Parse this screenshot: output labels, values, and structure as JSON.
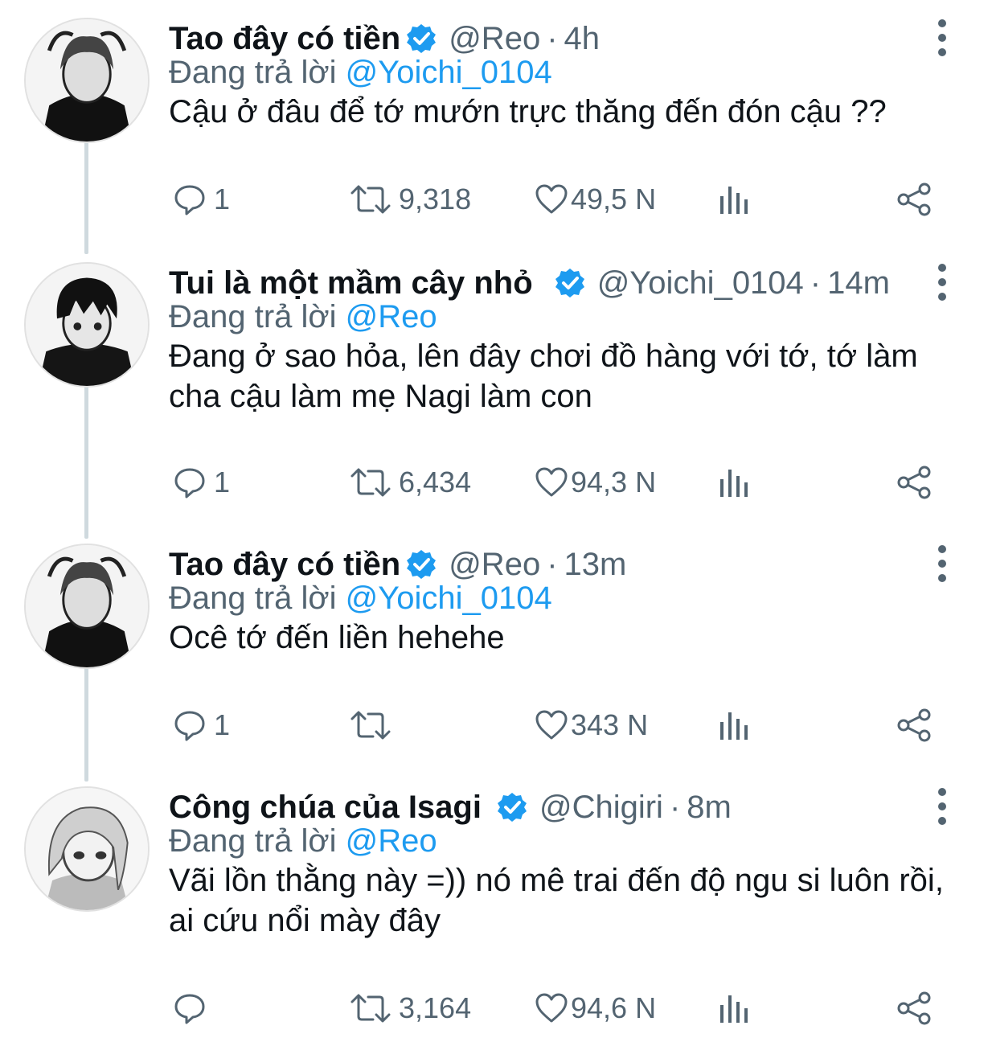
{
  "colors": {
    "accent": "#1d9bf0",
    "text": "#0f1419",
    "muted": "#536471",
    "thread_line": "#cfd9de"
  },
  "labels": {
    "replying_to": "Đang trả lời"
  },
  "icons": {
    "verified": "verified-badge-icon",
    "more": "more-vertical-icon",
    "reply": "reply-icon",
    "retweet": "retweet-icon",
    "like": "heart-icon",
    "analytics": "analytics-icon",
    "share": "share-icon"
  },
  "tweets": [
    {
      "display_name": "Tao đây có tiền",
      "handle": "@Reo",
      "separator": "·",
      "time": "4h",
      "replying_to": "@Yoichi_0104",
      "text": "Cậu ở đâu để tớ mướn trực thăng đến đón cậu ??",
      "stats": {
        "replies": "1",
        "retweets": "9,318",
        "likes": "49,5 N"
      }
    },
    {
      "display_name": "Tui là một mầm cây nhỏ",
      "handle": "@Yoichi_0104",
      "separator": "·",
      "time": "14m",
      "replying_to": "@Reo",
      "text": "Đang ở sao hỏa, lên đây chơi đồ hàng với tớ, tớ làm cha cậu làm mẹ Nagi làm con",
      "stats": {
        "replies": "1",
        "retweets": "6,434",
        "likes": "94,3 N"
      }
    },
    {
      "display_name": "Tao đây có tiền",
      "handle": "@Reo",
      "separator": "·",
      "time": "13m",
      "replying_to": "@Yoichi_0104",
      "text": "Ocê tớ đến liền hehehe",
      "stats": {
        "replies": "1",
        "retweets": "",
        "likes": "343 N"
      }
    },
    {
      "display_name": "Công chúa của Isagi",
      "handle": "@Chigiri",
      "separator": "·",
      "time": "8m",
      "replying_to": "@Reo",
      "text": "Vãi lồn thằng này =)) nó mê trai đến độ ngu si luôn rồi, ai cứu nổi mày đây",
      "stats": {
        "replies": "",
        "retweets": "3,164",
        "likes": "94,6 N"
      }
    }
  ]
}
